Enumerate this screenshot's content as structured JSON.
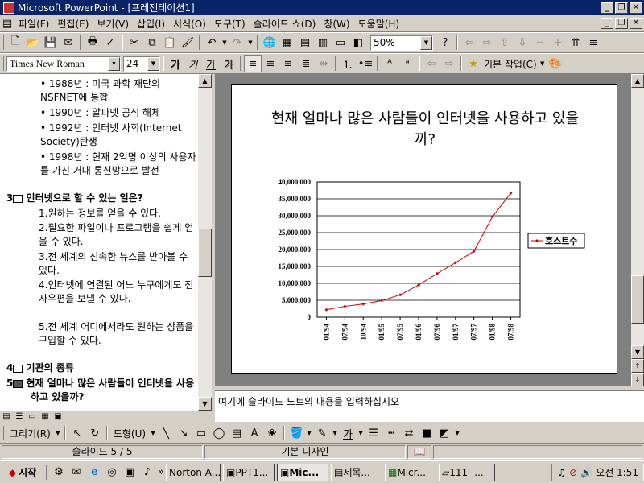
{
  "window": {
    "title": "Microsoft PowerPoint - [프레젠테이션1]"
  },
  "menu": [
    "파일(F)",
    "편집(E)",
    "보기(V)",
    "삽입(I)",
    "서식(O)",
    "도구(T)",
    "슬라이드 쇼(D)",
    "창(W)",
    "도움말(H)"
  ],
  "toolbar": {
    "zoom": "50%"
  },
  "format": {
    "font": "Times New Roman",
    "size": "24",
    "bold": "가",
    "italic": "가",
    "underline": "가",
    "shadow": "가",
    "common_tasks": "기본 작업(C)"
  },
  "outline": {
    "bullets_top": [
      "1988년 : 미국 과학 재단의 NSFNET에 통합",
      "1990년 : 알파넷 공식 해체",
      "1992년 : 인터넷 사회(Internet Society)탄생",
      "1998년 : 현재 2억명 이상의 사용자를 가진 거대 통신망으로 발전"
    ],
    "slide3_num": "3",
    "slide3_title": "인터넷으로 할 수 있는 일은?",
    "slide3_items": [
      "1.원하는 정보를 얻을 수 있다.",
      "2.필요한 파일이나 프로그램을 쉽게 얻을 수 있다.",
      "3.전 세계의 신속한 뉴스를 받아볼 수 있다.",
      "4.인터넷에 연결된 어느 누구에게도 전자우편을 보낼 수 있다.",
      "5.전 세계 어디에서라도 원하는 상품을 구입할 수 있다."
    ],
    "slide4_num": "4",
    "slide4_title": "기관의 종류",
    "slide5_num": "5",
    "slide5_title": "현재 얼마나 많은 사람들이 인터넷을 사용하고 있을까?"
  },
  "slide": {
    "title": "현재 얼마나 많은 사람들이 인터넷을 사용하고 있을까?"
  },
  "chart_data": {
    "type": "line",
    "title": "",
    "xlabel": "",
    "ylabel": "",
    "categories": [
      "01/94",
      "07/94",
      "10/94",
      "01/95",
      "07/95",
      "01/96",
      "07/96",
      "01/97",
      "07/97",
      "01/98",
      "07/98"
    ],
    "series": [
      {
        "name": "호스트수",
        "values": [
          2200000,
          3200000,
          3900000,
          4900000,
          6600000,
          9500000,
          12900000,
          16100000,
          19500000,
          29700000,
          36700000
        ]
      }
    ],
    "ylim": [
      0,
      40000000
    ],
    "yticks": [
      "40,000,000",
      "35,000,000",
      "30,000,000",
      "25,000,000",
      "20,000,000",
      "15,000,000",
      "10,000,000",
      "5,000,000",
      "0"
    ],
    "grid": true,
    "legend": "right",
    "line_color": "#cc0000"
  },
  "notes": {
    "placeholder": "여기에 슬라이드 노트의 내용을 입력하십시오"
  },
  "drawbar": {
    "draw": "그리기(R)",
    "autoshapes": "도형(U)"
  },
  "status": {
    "slide": "슬라이드 5 / 5",
    "design": "기본 디자인"
  },
  "taskbar": {
    "start": "시작",
    "tasks": [
      "Norton A...",
      "PPT1...",
      "Mic...",
      "제목...",
      "Micr...",
      "111 -..."
    ],
    "clock": "오전 1:51"
  }
}
